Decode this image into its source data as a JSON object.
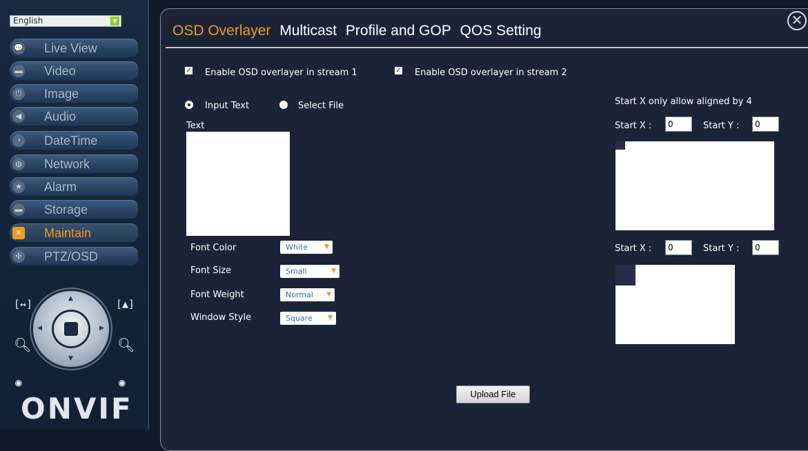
{
  "sidebar": {
    "language": "English",
    "items": [
      {
        "label": "Live View",
        "icon": "chat-bubble-icon"
      },
      {
        "label": "Video",
        "icon": "camera-icon"
      },
      {
        "label": "Image",
        "icon": "power-icon"
      },
      {
        "label": "Audio",
        "icon": "speaker-icon"
      },
      {
        "label": "DateTime",
        "icon": "clock-icon"
      },
      {
        "label": "Network",
        "icon": "globe-icon"
      },
      {
        "label": "Alarm",
        "icon": "star-icon"
      },
      {
        "label": "Storage",
        "icon": "folder-icon"
      },
      {
        "label": "Maintain",
        "icon": "tools-icon"
      },
      {
        "label": "PTZ/OSD",
        "icon": "joystick-icon"
      }
    ],
    "active_item": "Maintain",
    "logo_text": "ONVIF"
  },
  "tabs": [
    {
      "label": "OSD Overlayer",
      "active": true
    },
    {
      "label": "Multicast",
      "active": false
    },
    {
      "label": "Profile and GOP",
      "active": false
    },
    {
      "label": "QOS Setting",
      "active": false
    }
  ],
  "osd": {
    "enable_stream1": {
      "label": "Enable OSD overlayer in stream 1",
      "checked": true
    },
    "enable_stream2": {
      "label": "Enable OSD overlayer in stream 2",
      "checked": true
    },
    "source_options": [
      {
        "label": "Input Text",
        "selected": true
      },
      {
        "label": "Select File",
        "selected": false
      }
    ],
    "text_label": "Text",
    "text_value": "",
    "font_color": {
      "label": "Font Color",
      "value": "White"
    },
    "font_size": {
      "label": "Font Size",
      "value": "Small"
    },
    "font_weight": {
      "label": "Font Weight",
      "value": "Normal"
    },
    "window_style": {
      "label": "Window Style",
      "value": "Square"
    },
    "align_note": "Start X only allow aligned by 4",
    "stream1_pos": {
      "x_label": "Start X :",
      "x": "0",
      "y_label": "Start Y :",
      "y": "0"
    },
    "stream2_pos": {
      "x_label": "Start X :",
      "x": "0",
      "y_label": "Start Y :",
      "y": "0"
    },
    "upload_label": "Upload File"
  },
  "colors": {
    "accent": "#f39a1b",
    "panel_bg": "#1b2437",
    "sidebar_bg": "#182a40"
  }
}
